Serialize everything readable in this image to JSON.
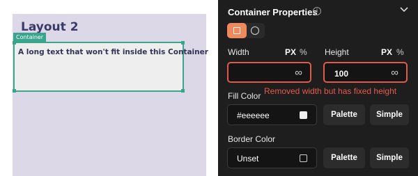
{
  "canvas": {
    "artboard_title": "Layout 2",
    "container_tag": "Container",
    "container_text": "A long text that won't fit inside this Container"
  },
  "panel": {
    "title": "Container Properties",
    "info_icon": "i",
    "collapse_icon": "chevron-down-icon",
    "width": {
      "label": "Width",
      "unit_px": "PX",
      "unit_pct": "%",
      "value": "",
      "infinity": "∞"
    },
    "height": {
      "label": "Height",
      "unit_px": "PX",
      "unit_pct": "%",
      "value": "100",
      "infinity": "∞"
    },
    "error_message": "Removed width but has fixed height",
    "fill": {
      "label": "Fill Color",
      "value": "#eeeeee",
      "palette": "Palette",
      "simple": "Simple"
    },
    "border": {
      "label": "Border Color",
      "value": "Unset",
      "palette": "Palette",
      "simple": "Simple"
    }
  },
  "colors": {
    "accent": "#f0895c",
    "error": "#e25a4a",
    "selection": "#3aa58c",
    "panel_bg": "#1e1e1e"
  }
}
